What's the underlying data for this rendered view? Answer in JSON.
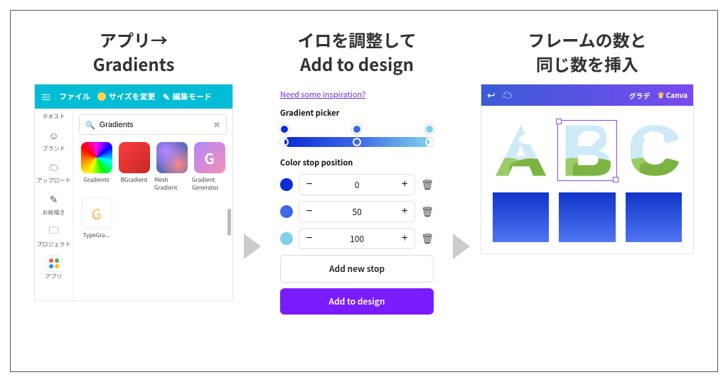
{
  "headings": {
    "c1a": "アプリ→",
    "c1b": "Gradients",
    "c2a": "イロを調整して",
    "c2b": "Add to design",
    "c3a": "フレームの数と",
    "c3b": "同じ数を挿入"
  },
  "panel1": {
    "topbar": {
      "file": "ファイル",
      "resize": "サイズを変更",
      "edit": "編集モード"
    },
    "side": {
      "text": "テキスト",
      "brand": "ブランド",
      "upload": "アップロード",
      "draw": "お絵描き",
      "project": "プロジェクト",
      "apps": "アプリ"
    },
    "search_value": "Gradients",
    "apps": [
      {
        "name": "Gradients"
      },
      {
        "name": "BGradient"
      },
      {
        "name": "Mesh Gradient"
      },
      {
        "name": "Gradient Generator"
      },
      {
        "name": "TypeGra..."
      }
    ]
  },
  "panel2": {
    "inspiration": "Need some inspiration?",
    "picker_label": "Gradient picker",
    "stops_label": "Color stop position",
    "colors": {
      "c0": "#0b2cd6",
      "c1": "#3d68e6",
      "c2": "#7fd1e8"
    },
    "stops": [
      {
        "pos": "0"
      },
      {
        "pos": "50"
      },
      {
        "pos": "100"
      }
    ],
    "add_stop": "Add new stop",
    "add_design": "Add to design"
  },
  "panel3": {
    "topbar": {
      "title": "グラデ",
      "canva": "Canva"
    }
  }
}
